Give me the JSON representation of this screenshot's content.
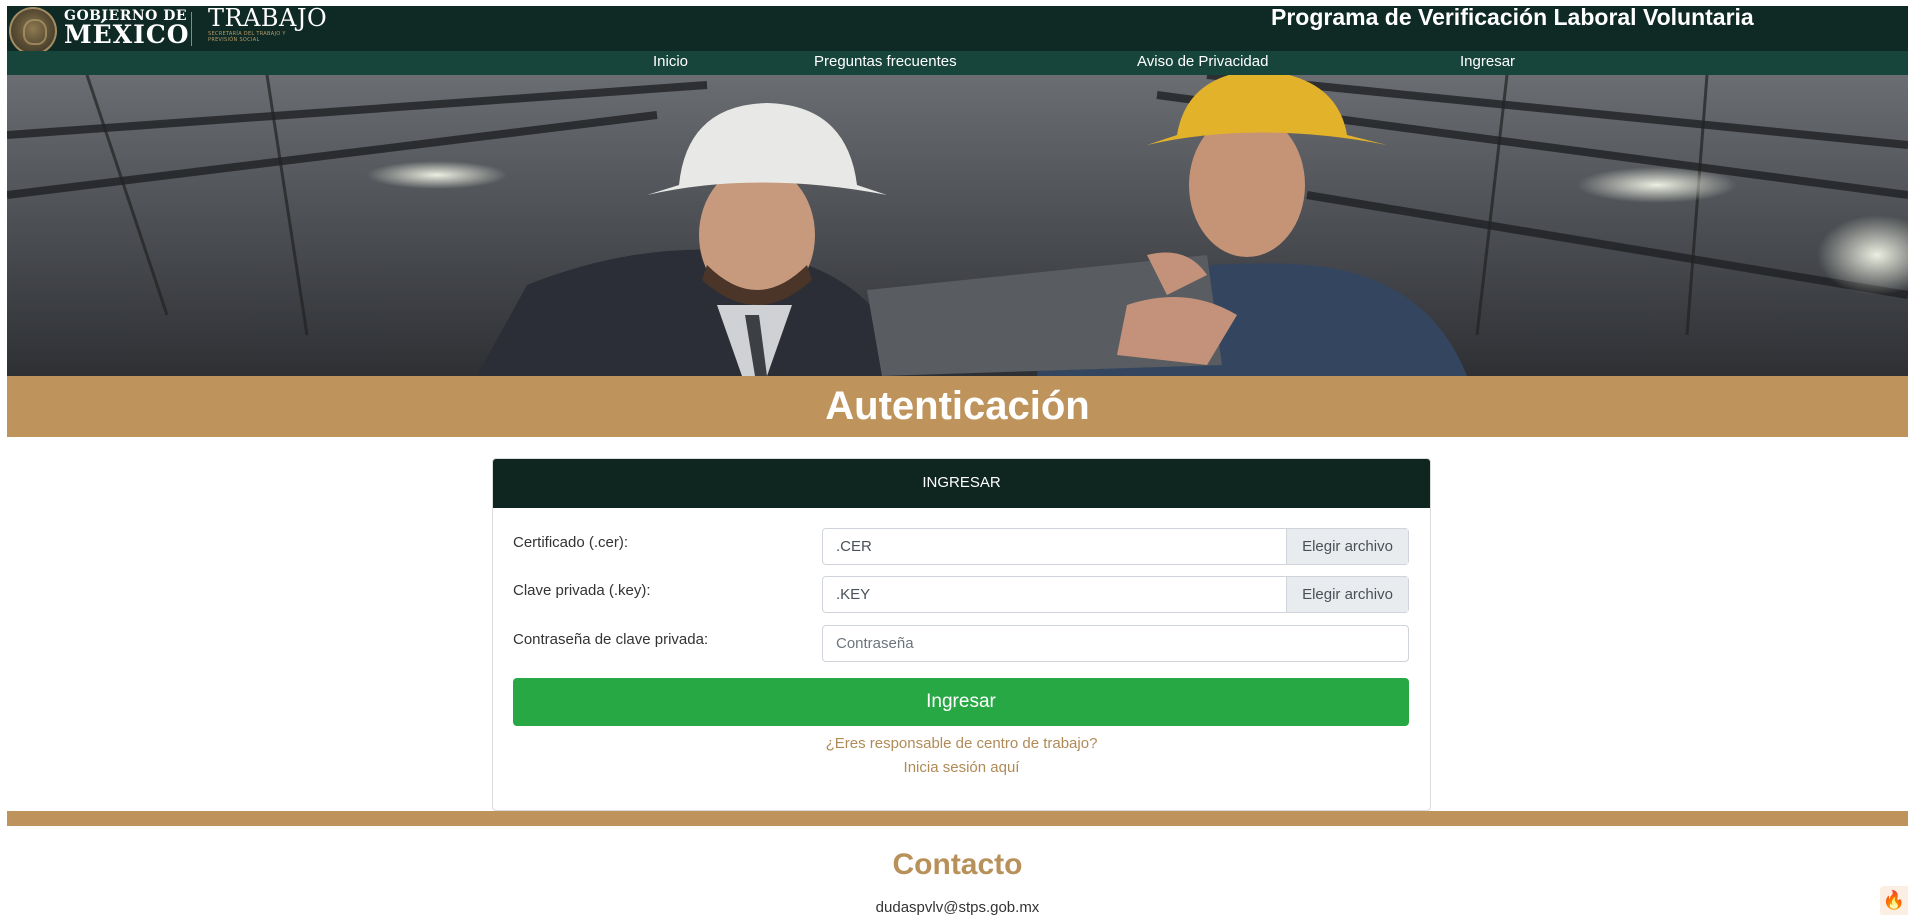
{
  "header": {
    "gob_top": "GOBIERNO DE",
    "gob_main": "MÉXICO",
    "dept": "TRABAJO",
    "dept_sub": "SECRETARÍA DEL TRABAJO Y PREVISIÓN SOCIAL",
    "program_title": "Programa de Verificación Laboral Voluntaria"
  },
  "nav": {
    "items": [
      {
        "label": "Inicio"
      },
      {
        "label": "Preguntas frecuentes"
      },
      {
        "label": "Aviso de Privacidad"
      },
      {
        "label": "Ingresar"
      }
    ]
  },
  "auth": {
    "title": "Autenticación"
  },
  "form": {
    "header": "INGRESAR",
    "cert_label": "Certificado (.cer):",
    "cert_value": ".CER",
    "cert_button": "Elegir archivo",
    "key_label": "Clave privada (.key):",
    "key_value": ".KEY",
    "key_button": "Elegir archivo",
    "password_label": "Contraseña de clave privada:",
    "password_placeholder": "Contraseña",
    "submit_label": "Ingresar",
    "responsible_question": "¿Eres responsable de centro de trabajo?",
    "responsible_link": "Inicia sesión aquí"
  },
  "contact": {
    "title": "Contacto",
    "email": "dudaspvlv@stps.gob.mx"
  },
  "colors": {
    "header_bg": "#0f2a24",
    "nav_bg": "#18453b",
    "gold": "#bf945c",
    "green_button": "#28a745"
  },
  "icons": {
    "seal": "national-seal-icon",
    "floating": "fire-icon"
  }
}
